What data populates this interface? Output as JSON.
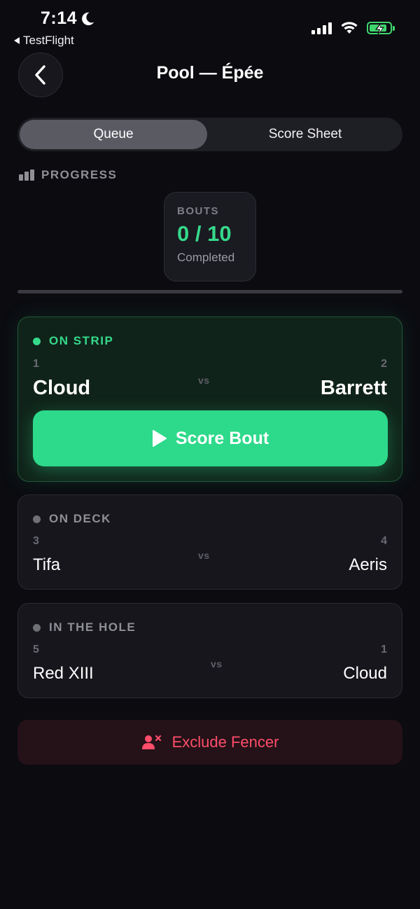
{
  "status_bar": {
    "time": "7:14",
    "back_app": "TestFlight",
    "moon_icon": "moon-icon",
    "signal_icon": "cellular-signal-icon",
    "wifi_icon": "wifi-icon",
    "battery_icon": "battery-charging-icon",
    "battery_color": "#3fd66e"
  },
  "nav": {
    "title": "Pool — Épée",
    "back_icon": "chevron-left-icon"
  },
  "tabs": [
    {
      "label": "Queue",
      "active": true
    },
    {
      "label": "Score Sheet",
      "active": false
    }
  ],
  "progress": {
    "header": "PROGRESS",
    "icon": "bar-chart-icon",
    "bouts_label": "BOUTS",
    "bouts_value": "0 / 10",
    "bouts_sub": "Completed",
    "completed": 0,
    "total": 10,
    "fraction": 0
  },
  "on_strip": {
    "label": "ON STRIP",
    "left_seed": "1",
    "left_name": "Cloud",
    "vs": "vs",
    "right_seed": "2",
    "right_name": "Barrett",
    "button_label": "Score Bout",
    "button_icon": "play-icon",
    "accent": "#35d98a"
  },
  "on_deck": {
    "label": "ON DECK",
    "left_seed": "3",
    "left_name": "Tifa",
    "vs": "vs",
    "right_seed": "4",
    "right_name": "Aeris"
  },
  "in_the_hole": {
    "label": "IN THE HOLE",
    "left_seed": "5",
    "left_name": "Red XIII",
    "vs": "vs",
    "right_seed": "1",
    "right_name": "Cloud"
  },
  "exclude": {
    "label": "Exclude Fencer",
    "icon": "remove-user-icon",
    "color": "#ff4d6a"
  }
}
